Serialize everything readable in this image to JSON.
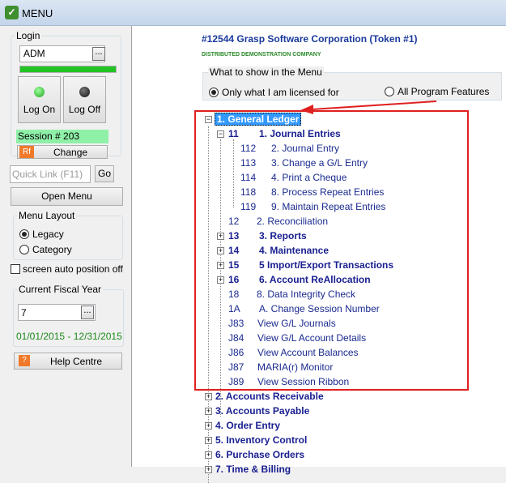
{
  "window": {
    "title": "MENU"
  },
  "login": {
    "legend": "Login",
    "user": "ADM",
    "user_browse": "...",
    "logon_label": "Log On",
    "logoff_label": "Log Off",
    "session": "Session # 203",
    "rf_icon": "Rf",
    "change_label": "Change"
  },
  "quicklink": {
    "placeholder": "Quick Link (F11)",
    "go_label": "Go"
  },
  "open_menu_label": "Open Menu",
  "menu_layout": {
    "legend": "Menu Layout",
    "legacy": "Legacy",
    "category": "Category",
    "selected": "Legacy"
  },
  "auto_position_label": "screen auto position off",
  "fiscal": {
    "legend": "Current Fiscal Year",
    "year": "7",
    "browse": "...",
    "range": "01/01/2015 - 12/31/2015"
  },
  "help": {
    "icon": "?",
    "label": "Help Centre"
  },
  "company": {
    "name": "#12544  Grasp Software Corporation (Token #1)",
    "subtitle": "DISTRIBUTED DEMONSTRATION COMPANY"
  },
  "show": {
    "legend": "What to show in the Menu",
    "licensed": "Only what I am licensed for",
    "all": "All Program Features",
    "selected": "licensed"
  },
  "tree": {
    "root": "1. General Ledger",
    "gl_items": [
      {
        "code": "11",
        "label": "1. Journal Entries",
        "bold": true,
        "expander": "−"
      },
      {
        "code": "112",
        "label": "2. Journal Entry"
      },
      {
        "code": "113",
        "label": "3. Change a G/L Entry"
      },
      {
        "code": "114",
        "label": "4.  Print a Cheque"
      },
      {
        "code": "118",
        "label": "8. Process Repeat Entries"
      },
      {
        "code": "119",
        "label": "9. Maintain Repeat Entries"
      },
      {
        "code": "12",
        "label": "2. Reconciliation"
      },
      {
        "code": "13",
        "label": "3. Reports",
        "bold": true,
        "expander": "+"
      },
      {
        "code": "14",
        "label": "4. Maintenance",
        "bold": true,
        "expander": "+"
      },
      {
        "code": "15",
        "label": "5 Import/Export Transactions",
        "bold": true,
        "expander": "+"
      },
      {
        "code": "16",
        "label": "6. Account ReAllocation",
        "bold": true,
        "expander": "+"
      },
      {
        "code": "18",
        "label": "8. Data Integrity Check"
      },
      {
        "code": "1A",
        "label": "A. Change Session Number"
      },
      {
        "code": "J83",
        "label": "View G/L Journals"
      },
      {
        "code": "J84",
        "label": "View G/L Account Details"
      },
      {
        "code": "J86",
        "label": "View Account Balances"
      },
      {
        "code": "J87",
        "label": "MARIA(r) Monitor"
      },
      {
        "code": "J89",
        "label": "View Session Ribbon"
      }
    ],
    "modules": [
      "2. Accounts Receivable",
      "3. Accounts Payable",
      "4. Order Entry",
      "5. Inventory Control",
      "6. Purchase Orders",
      "7. Time & Billing"
    ]
  },
  "colors": {
    "highlight": "#e02020",
    "session_bg": "#8ff0a8",
    "progress": "#23c325",
    "selection": "#3399ff"
  }
}
